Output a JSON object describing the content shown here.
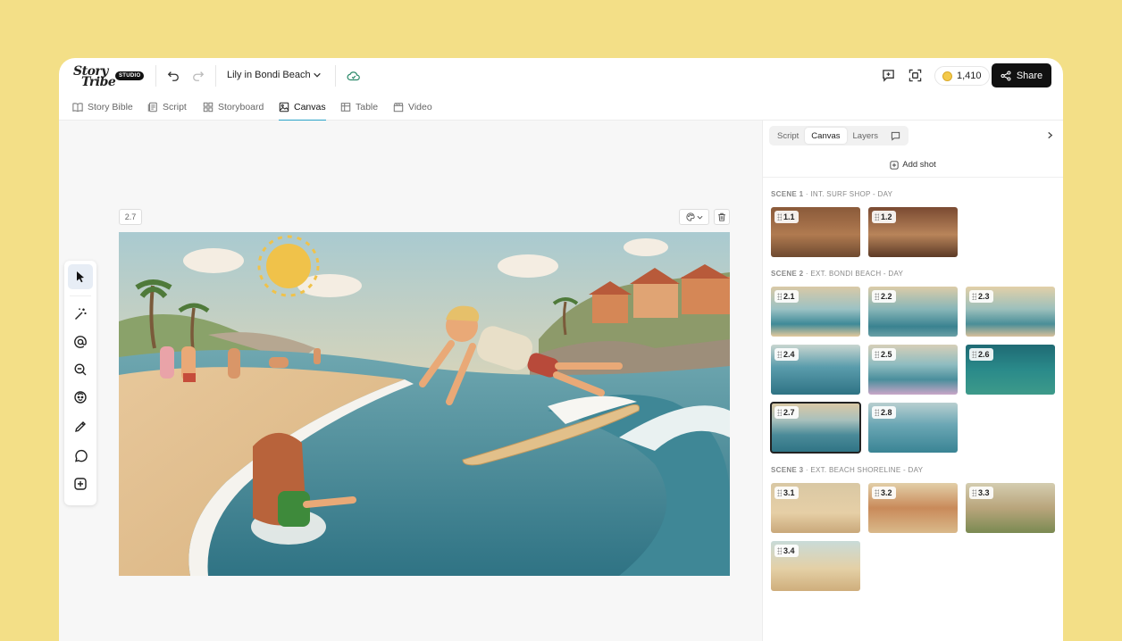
{
  "app": {
    "logo_line1": "Story",
    "logo_line2": "Tribe",
    "logo_badge": "STUDIO",
    "project_name": "Lily in Bondi Beach",
    "credits": "1,410",
    "share_label": "Share"
  },
  "nav": {
    "tabs": [
      {
        "label": "Story Bible",
        "icon": "book-icon"
      },
      {
        "label": "Script",
        "icon": "script-icon"
      },
      {
        "label": "Storyboard",
        "icon": "grid-icon"
      },
      {
        "label": "Canvas",
        "icon": "image-icon",
        "active": true
      },
      {
        "label": "Table",
        "icon": "table-icon"
      },
      {
        "label": "Video",
        "icon": "clapper-icon"
      }
    ]
  },
  "canvas": {
    "shot_label": "2.7"
  },
  "panel": {
    "tabs": [
      "Script",
      "Canvas",
      "Layers"
    ],
    "active_tab": "Canvas",
    "add_shot_label": "Add shot",
    "scenes": [
      {
        "number": "SCENE 1",
        "title": "INT. SURF SHOP - DAY",
        "shots": [
          "1.1",
          "1.2"
        ]
      },
      {
        "number": "SCENE 2",
        "title": "EXT. BONDI BEACH - DAY",
        "shots": [
          "2.1",
          "2.2",
          "2.3",
          "2.4",
          "2.5",
          "2.6",
          "2.7",
          "2.8"
        ]
      },
      {
        "number": "SCENE 3",
        "title": "EXT. BEACH SHORELINE - DAY",
        "shots": [
          "3.1",
          "3.2",
          "3.3",
          "3.4"
        ]
      }
    ],
    "selected_shot": "2.7"
  },
  "colors": {
    "background": "#f3df87",
    "accent": "#2aa3c9",
    "cloud_synced": "#2c8a6b"
  }
}
